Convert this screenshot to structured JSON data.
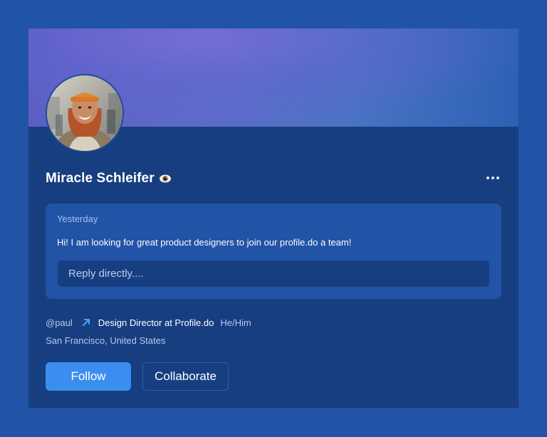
{
  "profile": {
    "name": "Miracle Schleifer",
    "name_icon": "eye-icon",
    "more_icon": "more-horizontal-icon",
    "handle": "@paul",
    "link_icon": "arrow-up-right-icon",
    "role": "Design Director at Profile.do",
    "pronouns": "He/Him",
    "location": "San Francisco, United States"
  },
  "message": {
    "time": "Yesterday",
    "text": "Hi! I am looking for great product designers to join our profile.do a team!",
    "reply_placeholder": "Reply directly....",
    "reply_value": ""
  },
  "actions": {
    "follow_label": "Follow",
    "collaborate_label": "Collaborate"
  },
  "colors": {
    "page_background": "#2153a6",
    "card_background": "#173e80",
    "message_background": "#2153a6",
    "primary_button": "#3b8ef0",
    "accent_link": "#4aa3ff"
  }
}
